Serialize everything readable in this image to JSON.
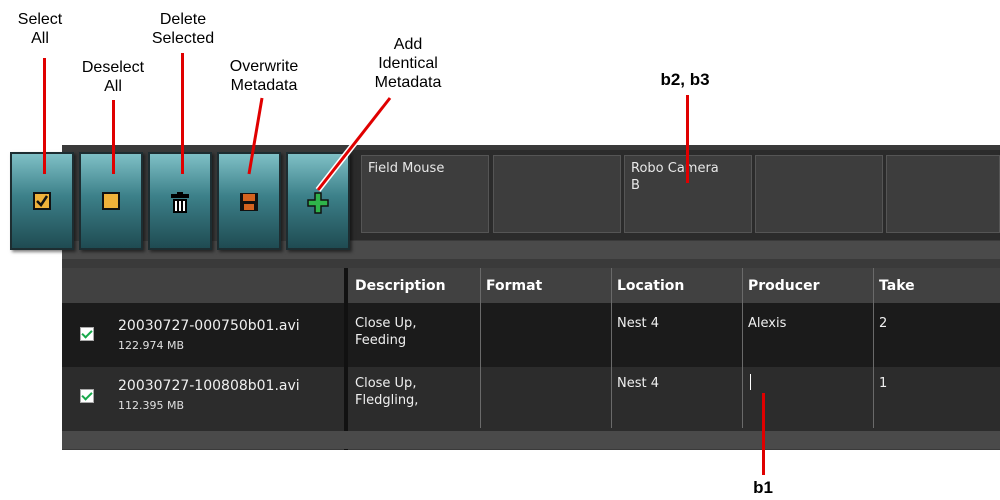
{
  "callouts": {
    "select_all": "Select\nAll",
    "deselect_all": "Deselect\nAll",
    "delete_selected": "Delete\nSelected",
    "overwrite_metadata": "Overwrite\nMetadata",
    "add_identical_metadata": "Add\nIdentical\nMetadata",
    "b2_b3": "b2, b3",
    "b1": "b1"
  },
  "colors": {
    "leader": "#e00000",
    "toolbar_button": "#3c8089",
    "checkbox_check": "#17a84a",
    "panel_bg": "#3a3a3a"
  },
  "toolbar": [
    {
      "name": "select-all",
      "icon": "checked-box-icon"
    },
    {
      "name": "deselect-all",
      "icon": "empty-box-icon"
    },
    {
      "name": "delete-selected",
      "icon": "trash-icon"
    },
    {
      "name": "overwrite-metadata",
      "icon": "floppy-disk-icon"
    },
    {
      "name": "add-identical-metadata",
      "icon": "plus-icon"
    }
  ],
  "header_cells": [
    "Field Mouse",
    "",
    "Robo Camera\nB",
    "",
    ""
  ],
  "columns": {
    "description": "Description",
    "format": "Format",
    "location": "Location",
    "producer": "Producer",
    "take": "Take"
  },
  "rows": [
    {
      "checked": true,
      "filename": "20030727-000750b01.avi",
      "size": "122.974 MB",
      "description": "Close Up,\nFeeding",
      "format": "",
      "location": "Nest 4",
      "producer": "Alexis",
      "take": "2"
    },
    {
      "checked": true,
      "filename": "20030727-100808b01.avi",
      "size": "112.395 MB",
      "description": "Close Up,\nFledgling,",
      "format": "",
      "location": "Nest 4",
      "producer": "",
      "take": "1"
    }
  ]
}
